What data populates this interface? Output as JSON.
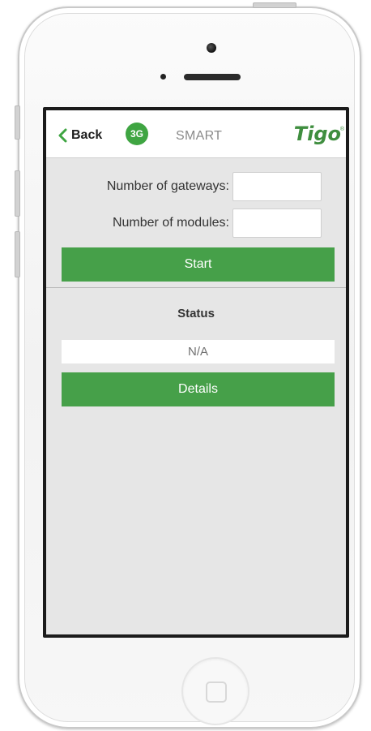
{
  "navbar": {
    "back_label": "Back",
    "network_badge": "3G",
    "mode_label": "SMART",
    "logo_text": "Tigo",
    "logo_mark": "®"
  },
  "form": {
    "gateways_label": "Number of gateways:",
    "gateways_value": "",
    "modules_label": "Number of modules:",
    "modules_value": "",
    "start_label": "Start"
  },
  "status": {
    "title": "Status",
    "value": "N/A",
    "details_label": "Details"
  },
  "colors": {
    "accent_green": "#46a049",
    "badge_green": "#3fa542",
    "logo_green": "#3f8e3f",
    "screen_bg": "#e6e6e6"
  },
  "icons": {
    "back": "chevron-left-icon"
  }
}
